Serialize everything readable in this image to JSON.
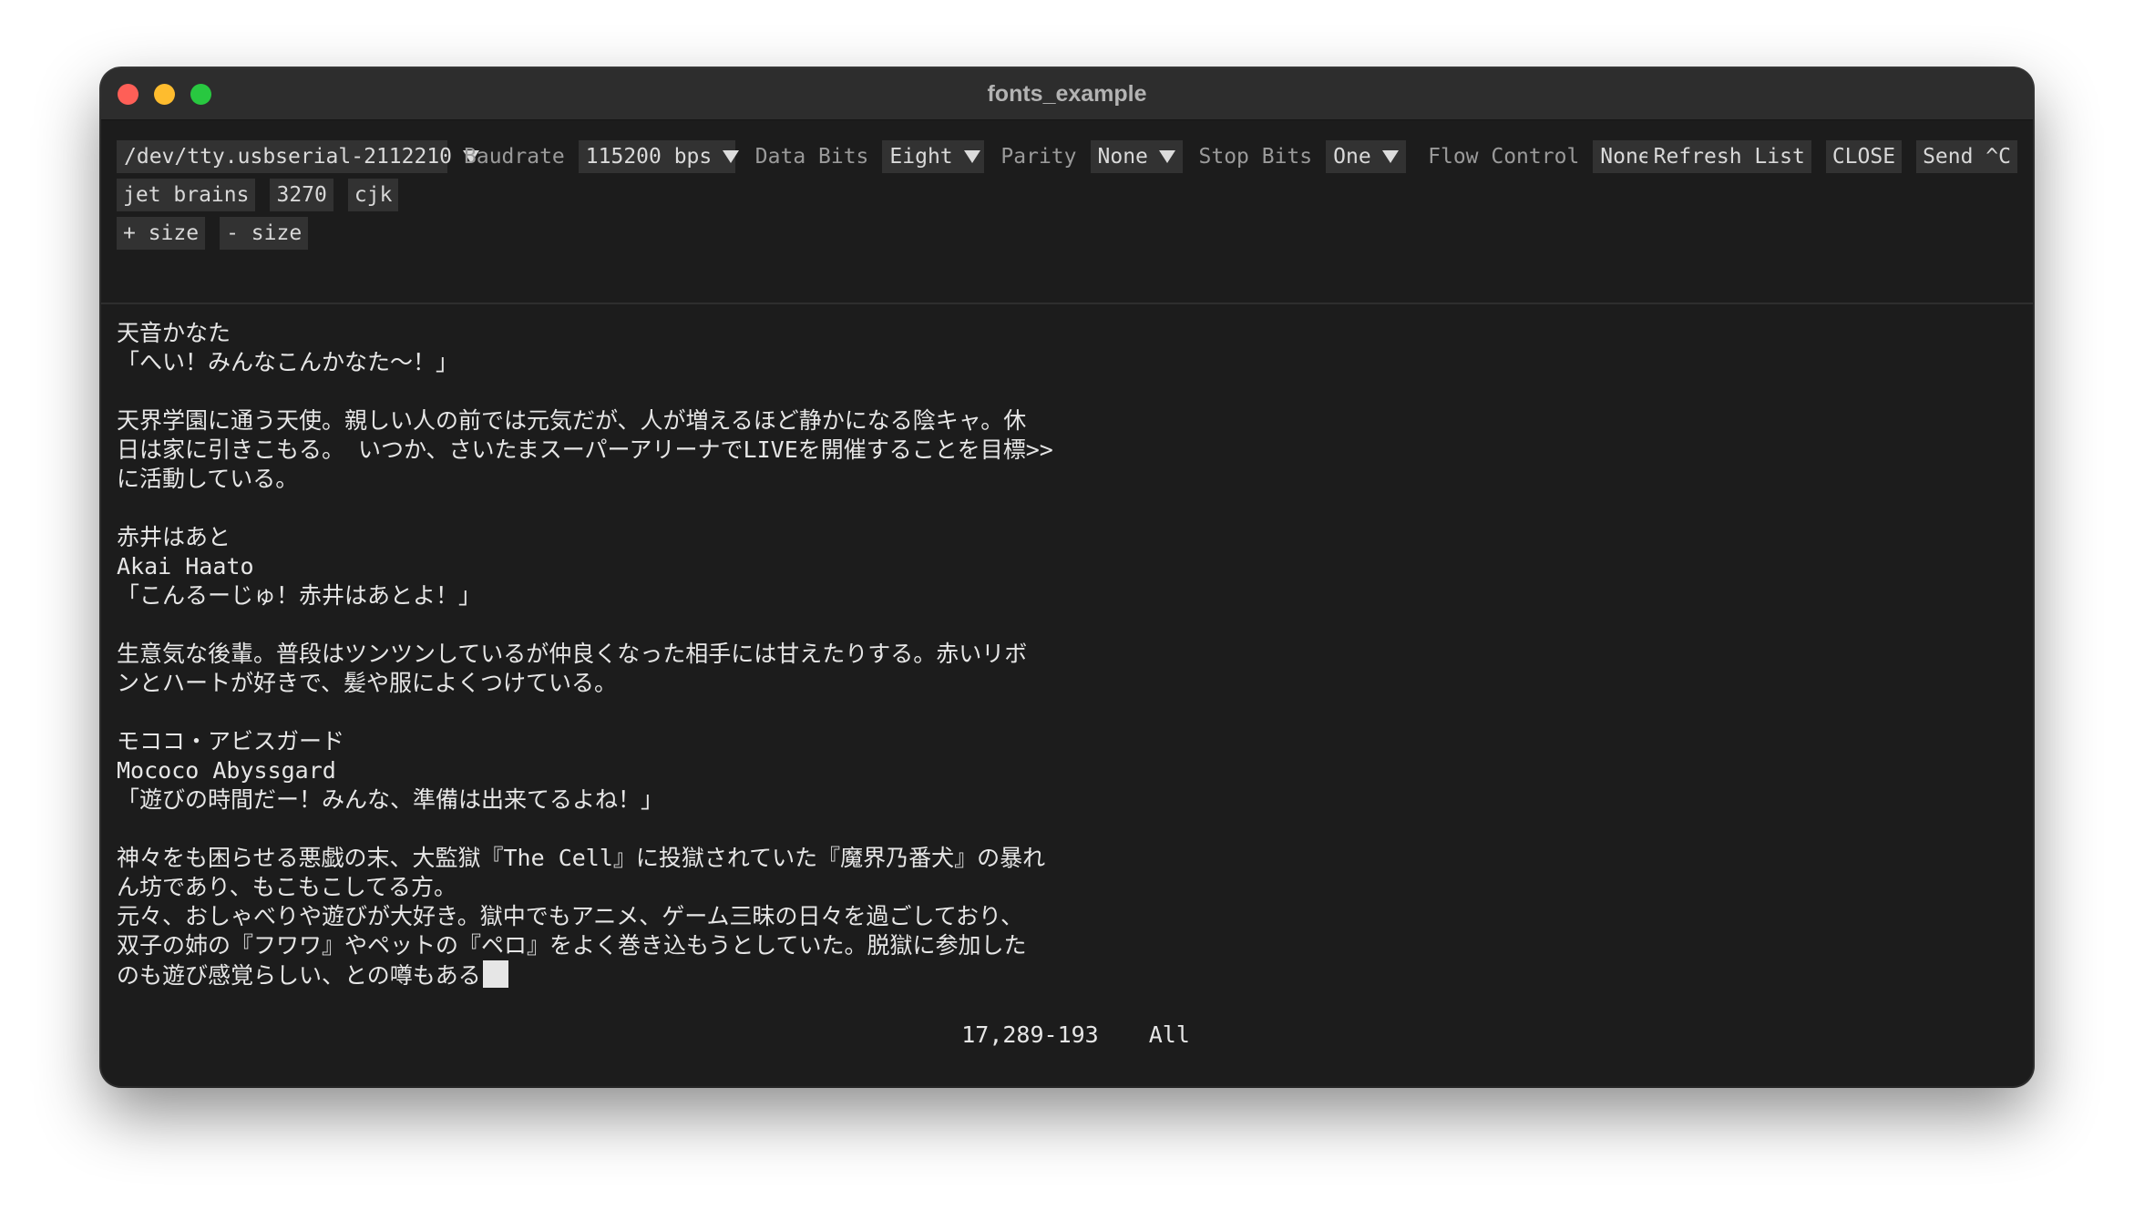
{
  "window": {
    "title": "fonts_example"
  },
  "toolbar": {
    "port": "/dev/tty.usbserial-2112210",
    "baudrate_label": "Baudrate",
    "baudrate": "115200 bps",
    "databits_label": "Data Bits",
    "databits": "Eight",
    "parity_label": "Parity",
    "parity": "None",
    "stopbits_label": "Stop Bits",
    "stopbits": "One",
    "flow_label": "Flow Control",
    "flow": "None",
    "refresh_label": "Refresh List",
    "close_label": "CLOSE",
    "send_label": "Send ^C"
  },
  "fonts": {
    "jetbrains": "jet brains",
    "font3270": "3270",
    "cjk": "cjk",
    "size_up": "+ size",
    "size_down": "- size"
  },
  "terminal": {
    "lines": [
      "天音かなた",
      "「へい！みんなこんかなた～！」",
      "",
      "天界学園に通う天使。親しい人の前では元気だが、人が増えるほど静かになる陰キャ。休",
      "日は家に引きこもる。 いつか、さいたまスーパーアリーナでLIVEを開催することを目標>>",
      "に活動している。",
      "",
      "赤井はあと",
      "Akai Haato",
      "「こんるーじゅ！赤井はあとよ！」",
      "",
      "生意気な後輩。普段はツンツンしているが仲良くなった相手には甘えたりする。赤いリボ",
      "ンとハートが好きで、髪や服によくつけている。",
      "",
      "モココ・アビスガード",
      "Mococo Abyssgard",
      "「遊びの時間だー！みんな、準備は出来てるよね！」",
      "",
      "神々をも困らせる悪戯の末、大監獄『The Cell』に投獄されていた『魔界乃番犬』の暴れ",
      "ん坊であり、もこもこしてる方。",
      "元々、おしゃべりや遊びが大好き。獄中でもアニメ、ゲーム三昧の日々を過ごしており、",
      "双子の姉の『フワワ』やペットの『ペロ』をよく巻き込もうとしていた。脱獄に参加した",
      "のも遊び感覚らしい、との噂もある"
    ],
    "status_position": "17,289-193",
    "status_scroll": "All"
  }
}
